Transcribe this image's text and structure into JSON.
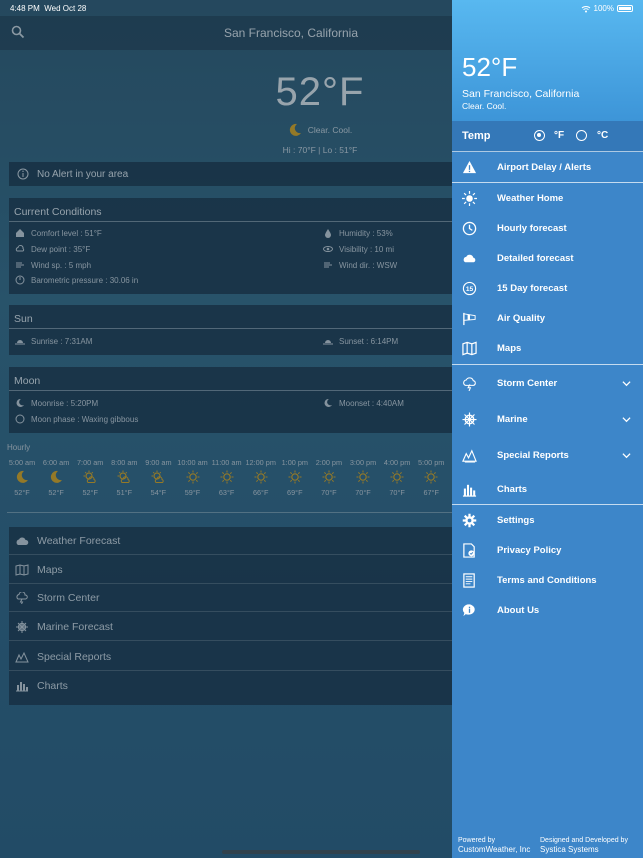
{
  "status": {
    "time": "4:48 PM",
    "date": "Wed Oct 28",
    "battery": "100%"
  },
  "header": {
    "city": "San Francisco, California"
  },
  "current": {
    "temp": "52°F",
    "condition": "Clear. Cool.",
    "hilo": "Hi : 70°F | Lo : 51°F"
  },
  "alert": "No Alert in your area",
  "conditions": {
    "title": "Current Conditions",
    "comfort": "Comfort level : 51°F",
    "dew": "Dew point : 35°F",
    "wind_speed": "Wind sp. : 5 mph",
    "pressure": "Barometric pressure : 30.06 in",
    "humidity": "Humidity : 53%",
    "visibility": "Visibility : 10 mi",
    "wind_dir": "Wind dir. : WSW"
  },
  "sun": {
    "title": "Sun",
    "sunrise": "Sunrise : 7:31AM",
    "sunset": "Sunset : 6:14PM"
  },
  "moon": {
    "title": "Moon",
    "moonrise": "Moonrise : 5:20PM",
    "moonset": "Moonset : 4:40AM",
    "phase": "Moon phase : Waxing gibbous"
  },
  "hourly": {
    "label": "Hourly",
    "items": [
      {
        "time": "5:00 am",
        "temp": "52°F",
        "icon": "moon-icon"
      },
      {
        "time": "6:00 am",
        "temp": "52°F",
        "icon": "moon-icon"
      },
      {
        "time": "7:00 am",
        "temp": "52°F",
        "icon": "sun-cloud-icon"
      },
      {
        "time": "8:00 am",
        "temp": "51°F",
        "icon": "sun-cloud-icon"
      },
      {
        "time": "9:00 am",
        "temp": "54°F",
        "icon": "sun-cloud-icon"
      },
      {
        "time": "10:00 am",
        "temp": "59°F",
        "icon": "sun-icon"
      },
      {
        "time": "11:00 am",
        "temp": "63°F",
        "icon": "sun-icon"
      },
      {
        "time": "12:00 pm",
        "temp": "66°F",
        "icon": "sun-icon"
      },
      {
        "time": "1:00 pm",
        "temp": "69°F",
        "icon": "sun-icon"
      },
      {
        "time": "2:00 pm",
        "temp": "70°F",
        "icon": "sun-icon"
      },
      {
        "time": "3:00 pm",
        "temp": "70°F",
        "icon": "sun-icon"
      },
      {
        "time": "4:00 pm",
        "temp": "70°F",
        "icon": "sun-icon"
      },
      {
        "time": "5:00 pm",
        "temp": "67°F",
        "icon": "sun-icon"
      }
    ]
  },
  "links": [
    "Weather Forecast",
    "Maps",
    "Storm Center",
    "Marine Forecast",
    "Special Reports",
    "Charts"
  ],
  "drawer": {
    "temp": "52°F",
    "city": "San Francisco, California",
    "condition": "Clear. Cool.",
    "temp_label": "Temp",
    "unit_f": "°F",
    "unit_c": "°C",
    "selected_unit": "F",
    "items": {
      "airport": "Airport Delay / Alerts",
      "home": "Weather Home",
      "hourly": "Hourly forecast",
      "detailed": "Detailed forecast",
      "day15": "15 Day forecast",
      "air": "Air Quality",
      "maps": "Maps",
      "storm": "Storm Center",
      "marine": "Marine",
      "special": "Special Reports",
      "charts": "Charts",
      "settings": "Settings",
      "privacy": "Privacy Policy",
      "terms": "Terms and Conditions",
      "about": "About Us"
    },
    "footer": {
      "powered_label": "Powered by",
      "powered_by": "CustomWeather, Inc",
      "designed_label": "Designed and Developed by",
      "designed_by": "Systica Systems"
    }
  },
  "colors": {
    "drawer_bg": "#3d86c9",
    "drawer_header": "#58b8f0",
    "card_bg": "#162d41",
    "hourly_icon": "#d9a520"
  }
}
